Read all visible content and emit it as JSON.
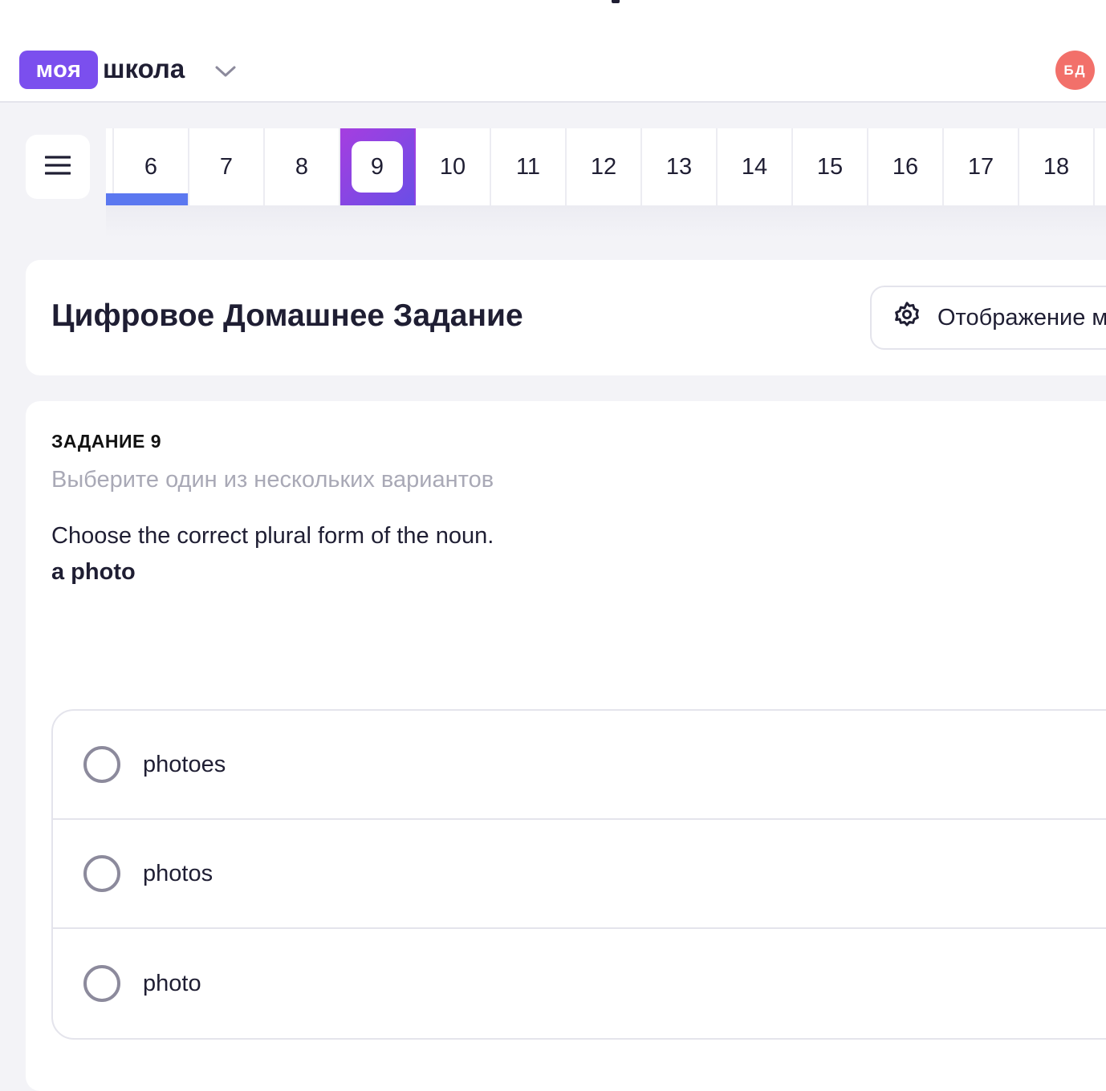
{
  "header": {
    "logo_badge": "моя",
    "logo_text": "школа",
    "avatar_initials": "БД"
  },
  "pager": {
    "items": [
      "6",
      "7",
      "8",
      "9",
      "10",
      "11",
      "12",
      "13",
      "14",
      "15",
      "16",
      "17",
      "18"
    ],
    "active": "9",
    "completed": [
      "6"
    ]
  },
  "title_card": {
    "title": "Цифровое Домашнее Задание",
    "display_button": "Отображение м"
  },
  "task": {
    "label": "ЗАДАНИЕ 9",
    "hint": "Выберите один из нескольких вариантов",
    "question": "Choose the correct plural form of the noun.",
    "word": "a photo",
    "options": [
      {
        "label": "photoes",
        "selected": false
      },
      {
        "label": "photos",
        "selected": false
      },
      {
        "label": "photo",
        "selected": false
      }
    ]
  },
  "colors": {
    "brand": "#7b4fee",
    "active_gradient_start": "#a53ee0",
    "active_gradient_end": "#6a4ee6",
    "progress_blue": "#5b78f0",
    "avatar": "#f2706a",
    "page_bg": "#f3f3f7"
  },
  "icons": {
    "menu": "hamburger-icon",
    "chevron": "chevron-down-icon",
    "settings": "gear-icon"
  }
}
